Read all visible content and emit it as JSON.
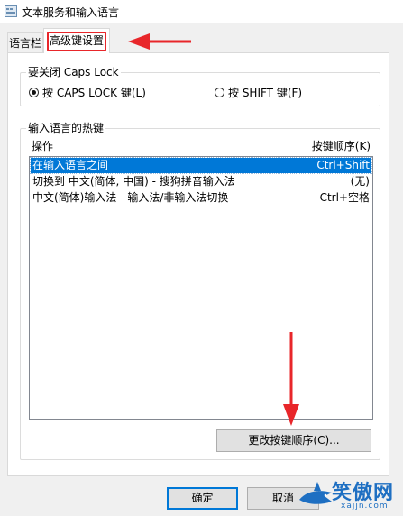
{
  "window": {
    "title": "文本服务和输入语言"
  },
  "tabs": [
    {
      "label": "语言栏",
      "selected": false
    },
    {
      "label": "高级键设置",
      "selected": true
    }
  ],
  "caps_group": {
    "legend": "要关闭 Caps Lock",
    "options": [
      {
        "label": "按 CAPS LOCK 键(L)",
        "checked": true
      },
      {
        "label": "按 SHIFT 键(F)",
        "checked": false
      }
    ]
  },
  "hotkeys_group": {
    "legend": "输入语言的热键",
    "columns": {
      "action": "操作",
      "key_sequence": "按键顺序(K)"
    },
    "rows": [
      {
        "action": "在输入语言之间",
        "keys": "Ctrl+Shift",
        "selected": true
      },
      {
        "action": "切换到 中文(简体, 中国) - 搜狗拼音输入法",
        "keys": "(无)",
        "selected": false
      },
      {
        "action": "中文(简体)输入法 - 输入法/非输入法切换",
        "keys": "Ctrl+空格",
        "selected": false
      }
    ],
    "change_button": "更改按键顺序(C)..."
  },
  "footer": {
    "ok": "确定",
    "cancel": "取消"
  },
  "watermark": {
    "text": "笑傲网",
    "url": "xajjn.com"
  },
  "colors": {
    "selection": "#0078d7",
    "annotation": "#e8262a",
    "watermark": "#1e6fc2"
  }
}
